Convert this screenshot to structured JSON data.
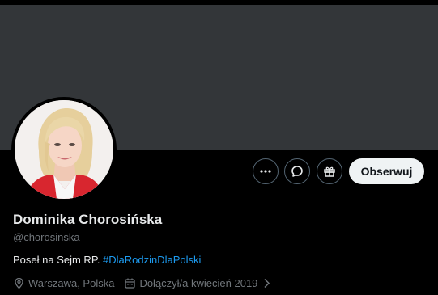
{
  "profile": {
    "display_name": "Dominika Chorosińska",
    "handle": "@chorosinska",
    "bio_text": "Poseł na Sejm RP. ",
    "bio_hashtag": "#DlaRodzinDlaPolski",
    "location": "Warszawa, Polska",
    "joined": "Dołączył/a kwiecień 2019"
  },
  "actions": {
    "more_icon": "more-icon",
    "message_icon": "message-icon",
    "gift_icon": "gift-icon",
    "follow_label": "Obserwuj"
  },
  "colors": {
    "background": "#000000",
    "banner": "#333639",
    "link": "#1d9bf0",
    "muted": "#71767b"
  }
}
